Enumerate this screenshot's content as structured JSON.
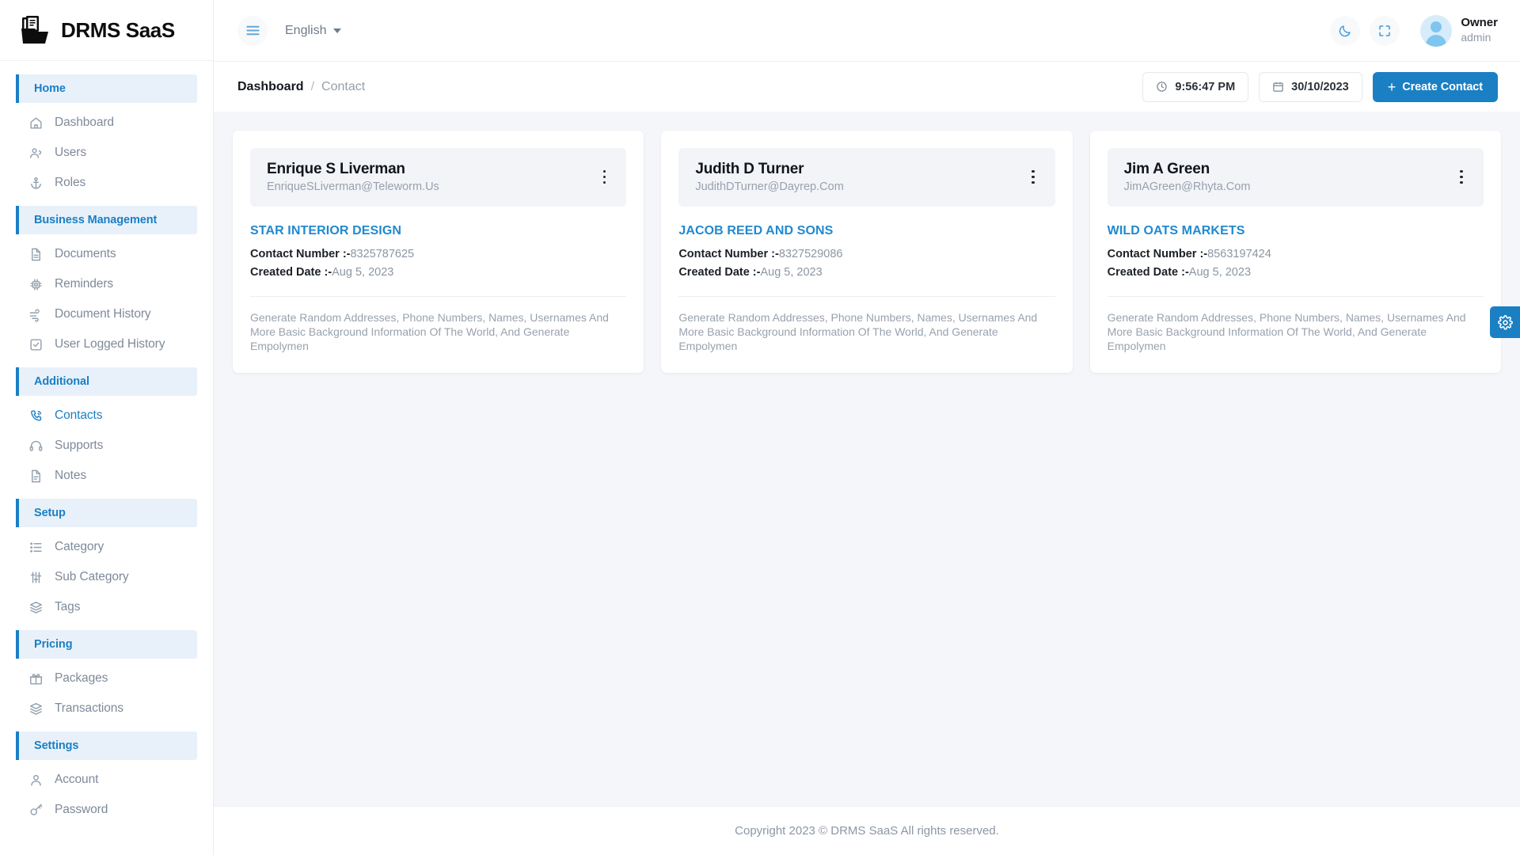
{
  "brand": {
    "name": "DRMS SaaS",
    "logo_icon": "documents-folder-icon"
  },
  "sidebar": {
    "groups": [
      {
        "label": "Home",
        "items": [
          {
            "label": "Dashboard",
            "icon": "home-icon",
            "active": false
          },
          {
            "label": "Users",
            "icon": "users-icon",
            "active": false
          },
          {
            "label": "Roles",
            "icon": "anchor-icon",
            "active": false
          }
        ]
      },
      {
        "label": "Business Management",
        "items": [
          {
            "label": "Documents",
            "icon": "document-icon",
            "active": false
          },
          {
            "label": "Reminders",
            "icon": "chip-icon",
            "active": false
          },
          {
            "label": "Document History",
            "icon": "wind-lines-icon",
            "active": false
          },
          {
            "label": "User Logged History",
            "icon": "checkbox-icon",
            "active": false
          }
        ]
      },
      {
        "label": "Additional",
        "items": [
          {
            "label": "Contacts",
            "icon": "phone-call-icon",
            "active": true
          },
          {
            "label": "Supports",
            "icon": "headset-icon",
            "active": false
          },
          {
            "label": "Notes",
            "icon": "note-icon",
            "active": false
          }
        ]
      },
      {
        "label": "Setup",
        "items": [
          {
            "label": "Category",
            "icon": "list-icon",
            "active": false
          },
          {
            "label": "Sub Category",
            "icon": "sliders-icon",
            "active": false
          },
          {
            "label": "Tags",
            "icon": "layers-icon",
            "active": false
          }
        ]
      },
      {
        "label": "Pricing",
        "items": [
          {
            "label": "Packages",
            "icon": "gift-icon",
            "active": false
          },
          {
            "label": "Transactions",
            "icon": "layers-icon",
            "active": false
          }
        ]
      },
      {
        "label": "Settings",
        "items": [
          {
            "label": "Account",
            "icon": "person-icon",
            "active": false
          },
          {
            "label": "Password",
            "icon": "key-icon",
            "active": false
          }
        ]
      }
    ]
  },
  "topbar": {
    "menu_icon": "hamburger-icon",
    "language": "English",
    "dark_mode_icon": "moon-icon",
    "fullscreen_icon": "fullscreen-icon",
    "user_name": "Owner",
    "user_role": "admin"
  },
  "subbar": {
    "breadcrumb_main": "Dashboard",
    "breadcrumb_separator": "/",
    "breadcrumb_current": "Contact",
    "time": "9:56:47 PM",
    "time_icon": "clock-icon",
    "date": "30/10/2023",
    "date_icon": "calendar-icon",
    "create_plus": "+",
    "create_label": "Create Contact"
  },
  "labels": {
    "contact_number": "Contact Number :-",
    "created_date": "Created Date :-"
  },
  "cards": [
    {
      "name": "Enrique S Liverman",
      "email": "EnriqueSLiverman@Teleworm.Us",
      "company": "STAR INTERIOR DESIGN",
      "contact_number": "8325787625",
      "created_date": "Aug 5, 2023",
      "description": "Generate Random Addresses, Phone Numbers, Names, Usernames And More Basic Background Information Of The World, And Generate Empolymen"
    },
    {
      "name": "Judith D Turner",
      "email": "JudithDTurner@Dayrep.Com",
      "company": "JACOB REED AND SONS",
      "contact_number": "8327529086",
      "created_date": "Aug 5, 2023",
      "description": "Generate Random Addresses, Phone Numbers, Names, Usernames And More Basic Background Information Of The World, And Generate Empolymen"
    },
    {
      "name": "Jim A Green",
      "email": "JimAGreen@Rhyta.Com",
      "company": "WILD OATS MARKETS",
      "contact_number": "8563197424",
      "created_date": "Aug 5, 2023",
      "description": "Generate Random Addresses, Phone Numbers, Names, Usernames And More Basic Background Information Of The World, And Generate Empolymen"
    }
  ],
  "settings_tab": {
    "icon": "gear-icon"
  },
  "footer": {
    "text": "Copyright 2023 © DRMS SaaS All rights reserved."
  },
  "colors": {
    "accent": "#1b7fc4",
    "section_bg": "#e8f1fa",
    "page_bg": "#f4f6f9"
  }
}
